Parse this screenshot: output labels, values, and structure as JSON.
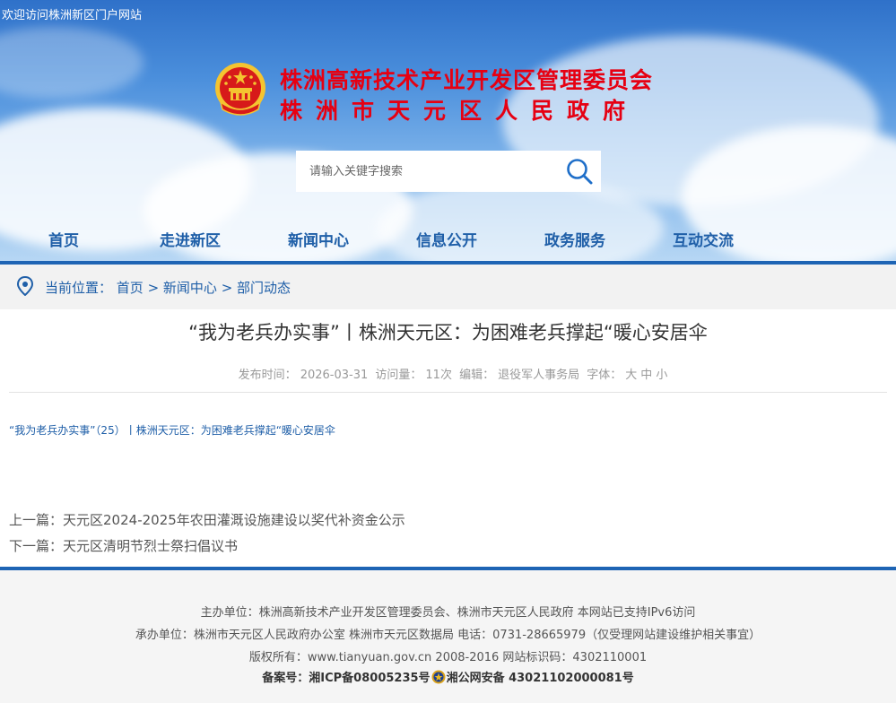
{
  "site": {
    "welcome": "欢迎访问株洲新区门户网站",
    "title_line1": "株洲高新技术产业开发区管理委员会",
    "title_line2": "株洲市天元区人民政府"
  },
  "search": {
    "placeholder": "请输入关键字搜索"
  },
  "nav": {
    "items": [
      "首页",
      "走进新区",
      "新闻中心",
      "信息公开",
      "政务服务",
      "互动交流"
    ]
  },
  "breadcrumb": {
    "label": "当前位置：",
    "items": [
      "首页",
      "新闻中心",
      "部门动态"
    ],
    "separator": " > "
  },
  "article": {
    "title": "“我为老兵办实事”丨株洲天元区：为困难老兵撑起“暖心安居伞",
    "meta": {
      "publish_label": "发布时间：",
      "publish_date": "2026-03-31",
      "views_label": "访问量：",
      "views": "11次",
      "editor_label": "编辑：",
      "editor": "退役军人事务局",
      "font_label": "字体：",
      "font_large": "大",
      "font_medium": "中",
      "font_small": "小"
    },
    "body": "“我为老兵办实事”（25）丨株洲天元区：为困难老兵撑起“暖心安居伞"
  },
  "prevnext": {
    "prev_label": "上一篇：",
    "prev_title": "天元区2024-2025年农田灌溉设施建设以奖代补资金公示",
    "next_label": "下一篇：",
    "next_title": "天元区清明节烈士祭扫倡议书"
  },
  "footer": {
    "line1": "主办单位：株洲高新技术产业开发区管理委员会、株洲市天元区人民政府 本网站已支持IPv6访问",
    "line2": "承办单位：株洲市天元区人民政府办公室 株洲市天元区数据局 电话：0731-28665979（仅受理网站建设维护相关事宜）",
    "line3": "版权所有：www.tianyuan.gov.cn 2008-2016 网站标识码：4302110001",
    "record_label": "备案号：",
    "icp": "湘ICP备08005235号",
    "police": "湘公网安备 43021102000081号"
  },
  "colors": {
    "title_red": "#e60012",
    "nav_blue": "#1f5fa8",
    "accent_line": "#1e64b4"
  },
  "icons": {
    "emblem": "national-emblem-icon",
    "search": "search-icon",
    "location": "location-pin-icon",
    "police": "police-badge-icon"
  }
}
